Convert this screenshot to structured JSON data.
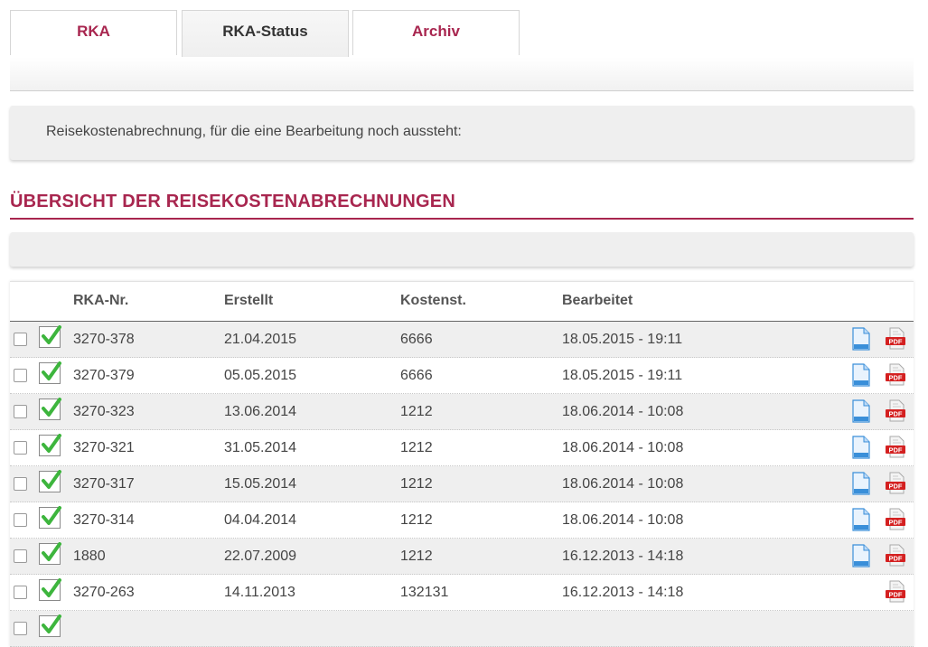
{
  "tabs": [
    {
      "label": "RKA"
    },
    {
      "label": "RKA-Status"
    },
    {
      "label": "Archiv"
    }
  ],
  "info": {
    "text": "Reisekostenabrechnung, für die eine Bearbeitung noch aussteht:"
  },
  "section": {
    "title": "ÜBERSICHT DER REISEKOSTENABRECHNUNGEN"
  },
  "colors": {
    "accent": "#a8264f",
    "row_alt": "#efefef",
    "check": "#3db53d",
    "doc": "#3a8fd9",
    "pdf": "#d42020"
  },
  "table": {
    "headers": {
      "nr": "RKA-Nr.",
      "created": "Erstellt",
      "cost": "Kostenst.",
      "edited": "Bearbeitet"
    },
    "rows": [
      {
        "nr": "3270-378",
        "created": "21.04.2015",
        "cost": "6666",
        "edited": "18.05.2015 - 19:11",
        "doc": true
      },
      {
        "nr": "3270-379",
        "created": "05.05.2015",
        "cost": "6666",
        "edited": "18.05.2015 - 19:11",
        "doc": true
      },
      {
        "nr": "3270-323",
        "created": "13.06.2014",
        "cost": "1212",
        "edited": "18.06.2014 - 10:08",
        "doc": true
      },
      {
        "nr": "3270-321",
        "created": "31.05.2014",
        "cost": "1212",
        "edited": "18.06.2014 - 10:08",
        "doc": true
      },
      {
        "nr": "3270-317",
        "created": "15.05.2014",
        "cost": "1212",
        "edited": "18.06.2014 - 10:08",
        "doc": true
      },
      {
        "nr": "3270-314",
        "created": "04.04.2014",
        "cost": "1212",
        "edited": "18.06.2014 - 10:08",
        "doc": true
      },
      {
        "nr": "1880",
        "created": "22.07.2009",
        "cost": "1212",
        "edited": "16.12.2013 - 14:18",
        "doc": true
      },
      {
        "nr": "3270-263",
        "created": "14.11.2013",
        "cost": "132131",
        "edited": "16.12.2013 - 14:18",
        "doc": false
      },
      {
        "nr": "",
        "created": "",
        "cost": "",
        "edited": "",
        "doc": false
      }
    ]
  }
}
